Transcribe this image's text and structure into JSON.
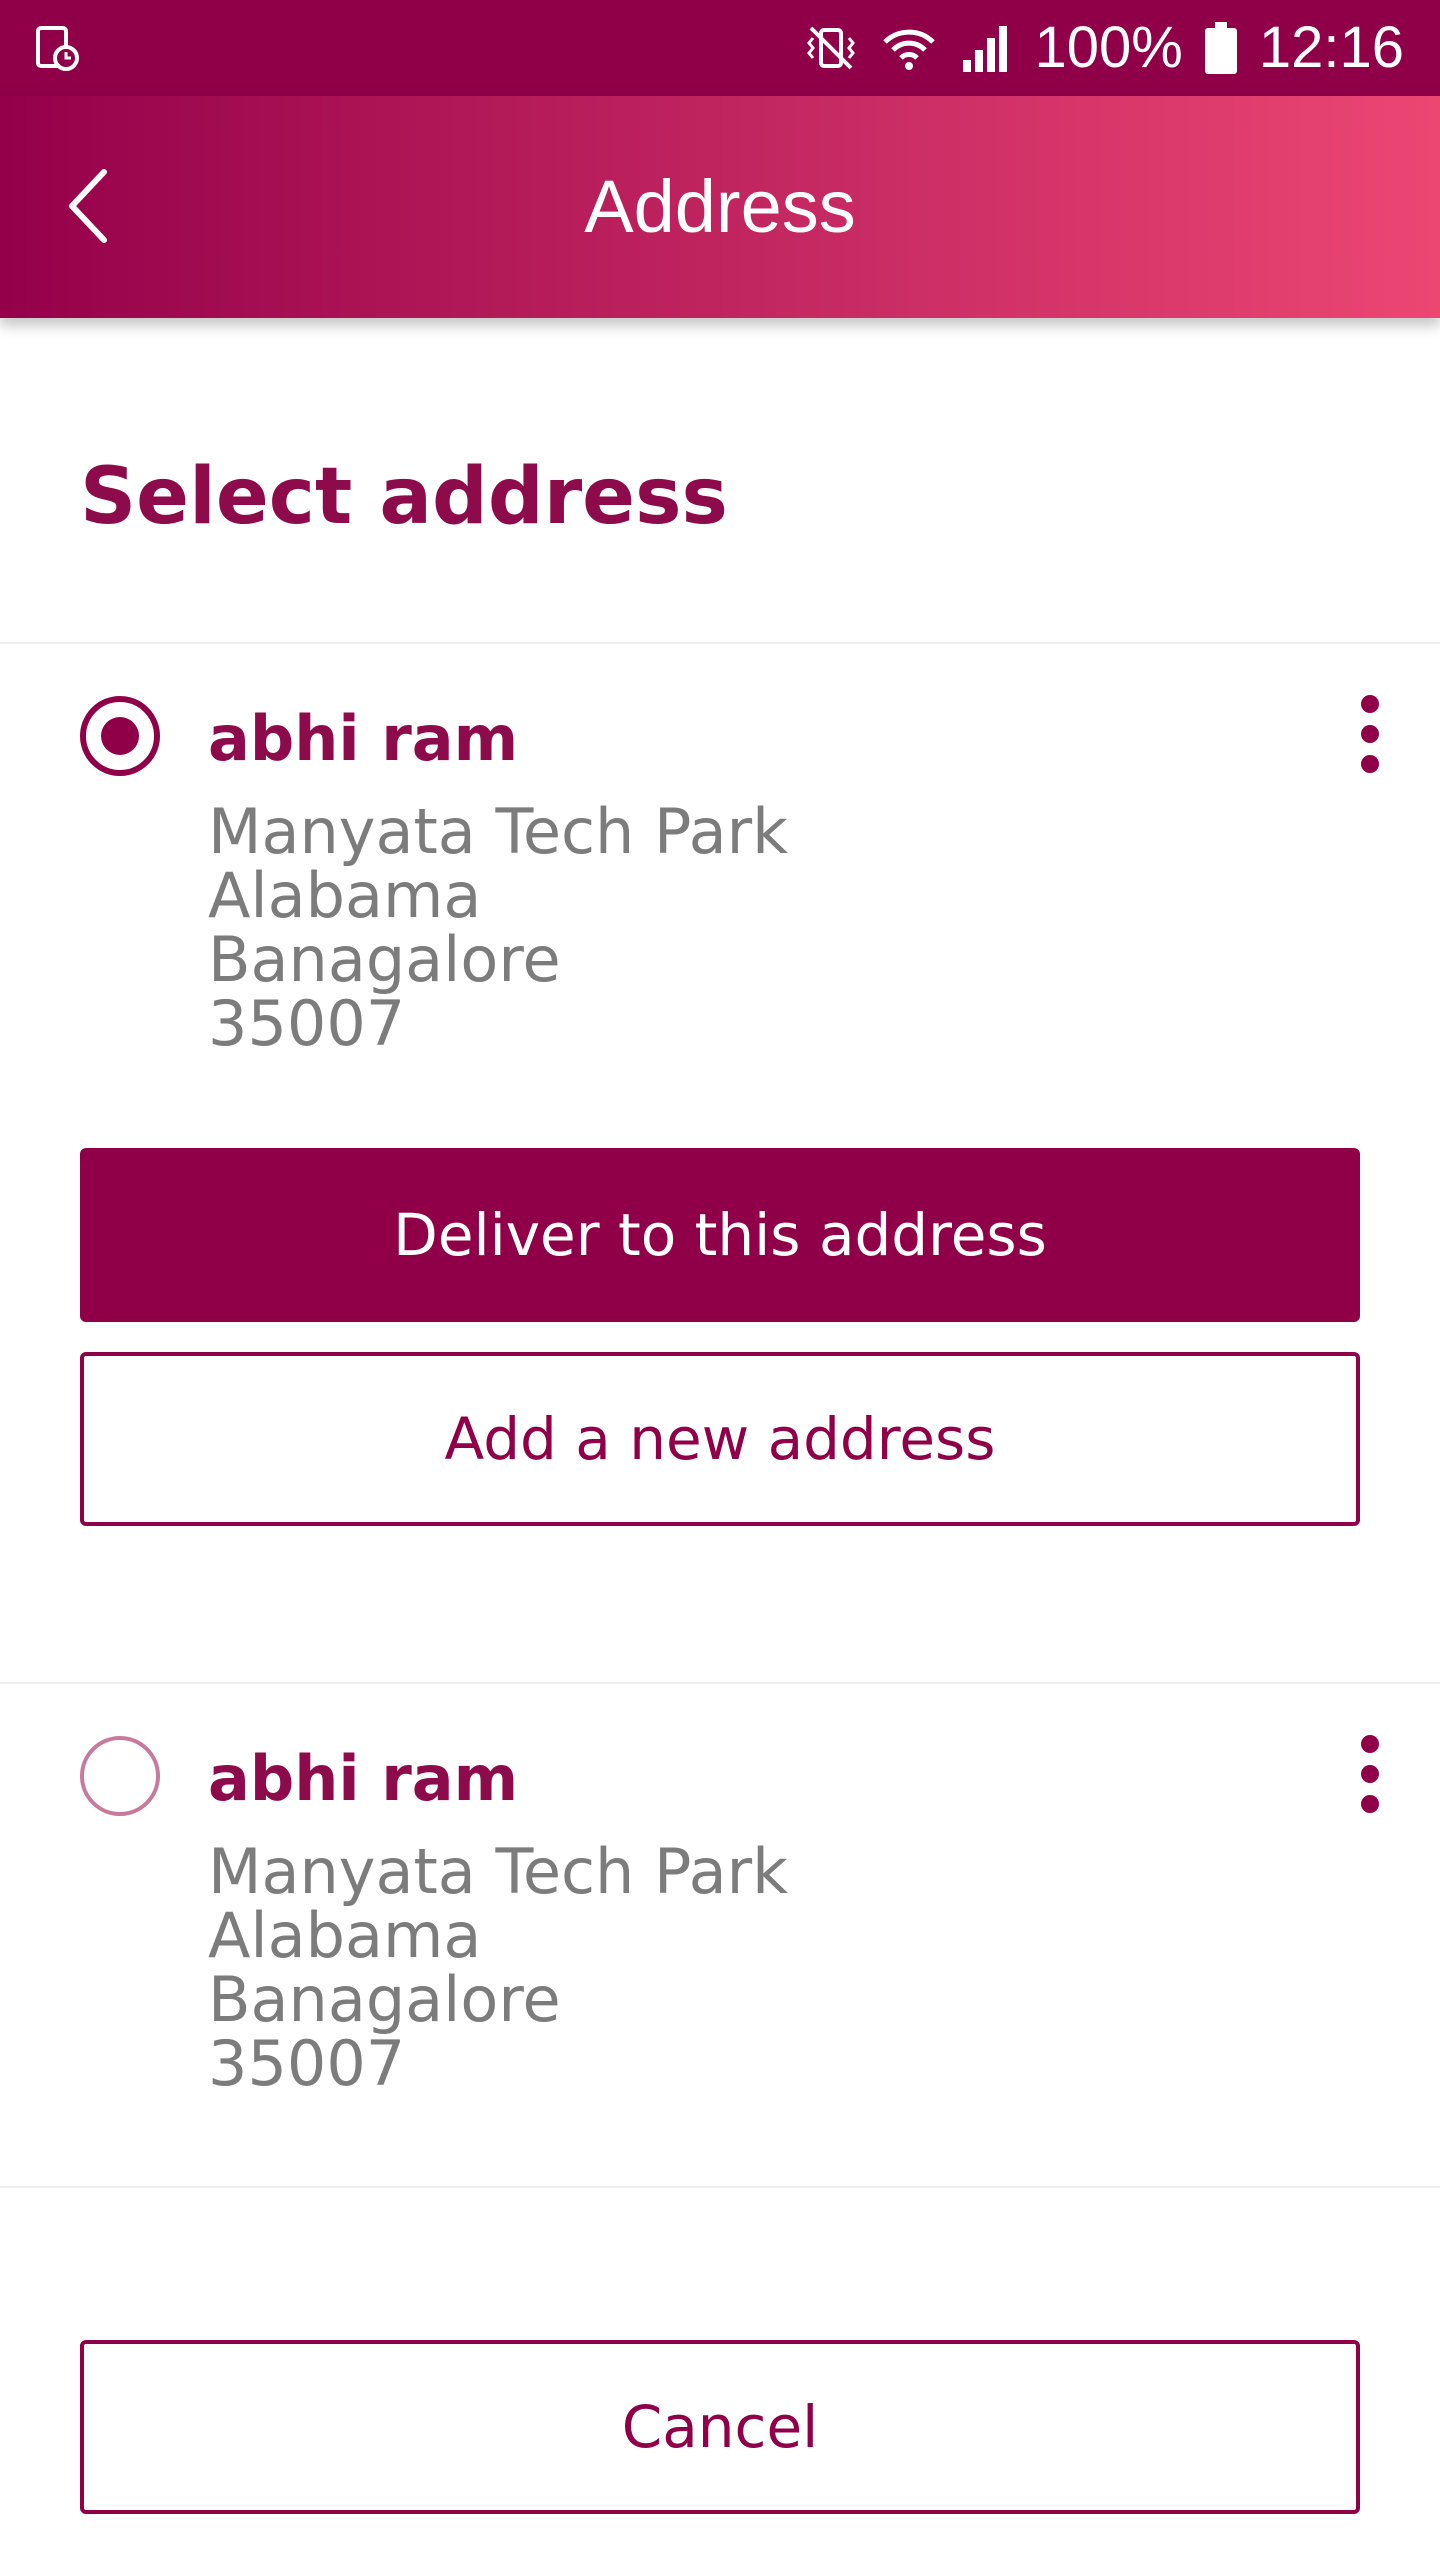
{
  "status_bar": {
    "battery": "100%",
    "time": "12:16",
    "icons": [
      "screen-record-icon",
      "vibrate-mute-icon",
      "wifi-icon",
      "signal-icon",
      "battery-icon"
    ]
  },
  "header": {
    "title": "Address",
    "back_icon": "chevron-left-icon"
  },
  "main": {
    "section_title": "Select address",
    "addresses": [
      {
        "selected": true,
        "name": "abhi ram",
        "line1": "Manyata Tech Park",
        "line2": "Alabama",
        "line3": "Banagalore",
        "line4": "35007"
      },
      {
        "selected": false,
        "name": "abhi ram",
        "line1": "Manyata Tech Park",
        "line2": "Alabama",
        "line3": "Banagalore",
        "line4": "35007"
      }
    ],
    "deliver_button": "Deliver to this address",
    "add_button": "Add a new address",
    "cancel_button": "Cancel"
  },
  "colors": {
    "brand": "#8f0049",
    "header_gradient_end": "#ec4673",
    "secondary_text": "#7c7c7c"
  }
}
